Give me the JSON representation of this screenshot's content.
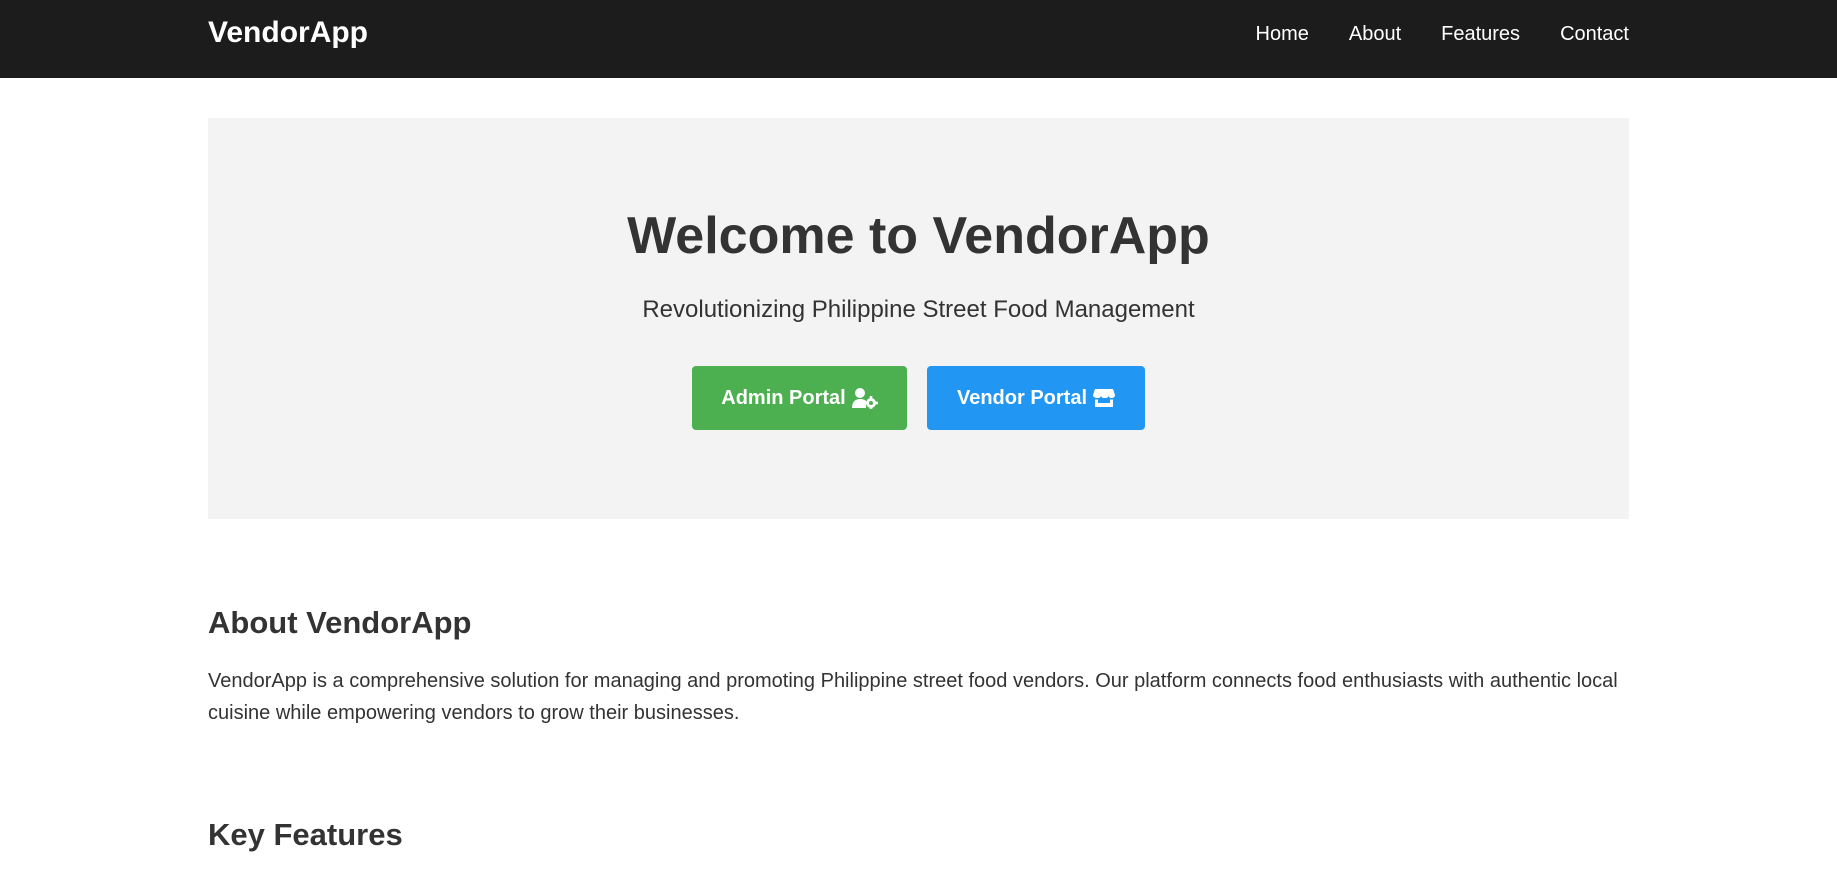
{
  "navbar": {
    "brand": "VendorApp",
    "links": [
      "Home",
      "About",
      "Features",
      "Contact"
    ]
  },
  "hero": {
    "title": "Welcome to VendorApp",
    "subtitle": "Revolutionizing Philippine Street Food Management",
    "admin_button": {
      "label": "Admin Portal",
      "icon": "user-gear-icon",
      "color": "#4caf50"
    },
    "vendor_button": {
      "label": "Vendor Portal",
      "icon": "store-icon",
      "color": "#2196f3"
    }
  },
  "about": {
    "title": "About VendorApp",
    "text": "VendorApp is a comprehensive solution for managing and promoting Philippine street food vendors. Our platform connects food enthusiasts with authentic local cuisine while empowering vendors to grow their businesses."
  },
  "features": {
    "title": "Key Features"
  },
  "colors": {
    "navbar_bg": "#1c1c1c",
    "hero_bg": "#f3f3f3",
    "text": "#333333"
  }
}
